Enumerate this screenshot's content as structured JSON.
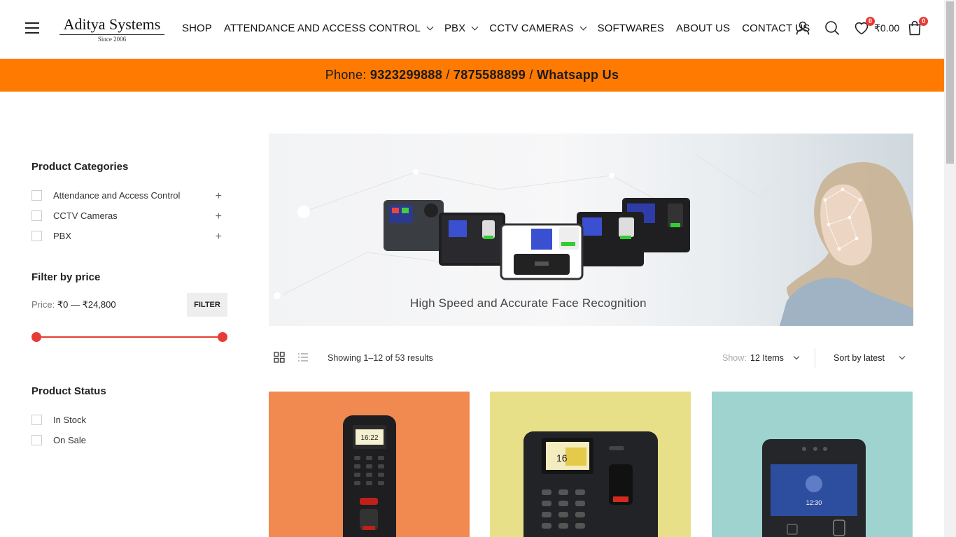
{
  "header": {
    "logo_main": "Aditya Systems",
    "logo_sub": "Since 2006",
    "nav": [
      {
        "label": "SHOP",
        "dropdown": false
      },
      {
        "label": "ATTENDANCE AND ACCESS CONTROL",
        "dropdown": true
      },
      {
        "label": "PBX",
        "dropdown": true
      },
      {
        "label": "CCTV CAMERAS",
        "dropdown": true
      },
      {
        "label": "SOFTWARES",
        "dropdown": false
      },
      {
        "label": "ABOUT US",
        "dropdown": false
      },
      {
        "label": "CONTACT US",
        "dropdown": false
      }
    ],
    "wishlist_count": "0",
    "cart_total": "₹0.00",
    "cart_count": "0"
  },
  "phonebar": {
    "prefix": "Phone: ",
    "phone1": "9323299888",
    "sep1": " / ",
    "phone2": "7875588899",
    "sep2": " / ",
    "whatsapp": "Whatsapp Us",
    "bg_color": "#ff7a00"
  },
  "sidebar": {
    "categories_title": "Product Categories",
    "categories": [
      {
        "label": "Attendance and Access Control"
      },
      {
        "label": "CCTV Cameras"
      },
      {
        "label": "PBX"
      }
    ],
    "price_title": "Filter by price",
    "price_prefix": "Price: ",
    "price_range": "₹0 — ₹24,800",
    "filter_label": "FILTER",
    "price_min_fraction": 0,
    "price_max_fraction": 1,
    "status_title": "Product Status",
    "statuses": [
      {
        "label": "In Stock"
      },
      {
        "label": "On Sale"
      }
    ]
  },
  "banner": {
    "caption": "High Speed and Accurate Face Recognition"
  },
  "toolbar": {
    "results": "Showing 1–12 of 53 results",
    "show_label": "Show:",
    "show_value": "12 Items",
    "sort_value": "Sort by latest"
  },
  "products": [
    {
      "bg": "#f08a50",
      "screen_time": "16:22"
    },
    {
      "bg": "#e8e088",
      "screen_time": "16"
    },
    {
      "bg": "#9fd3d0",
      "screen_time": "12:30"
    }
  ],
  "accent_color": "#e83b35"
}
